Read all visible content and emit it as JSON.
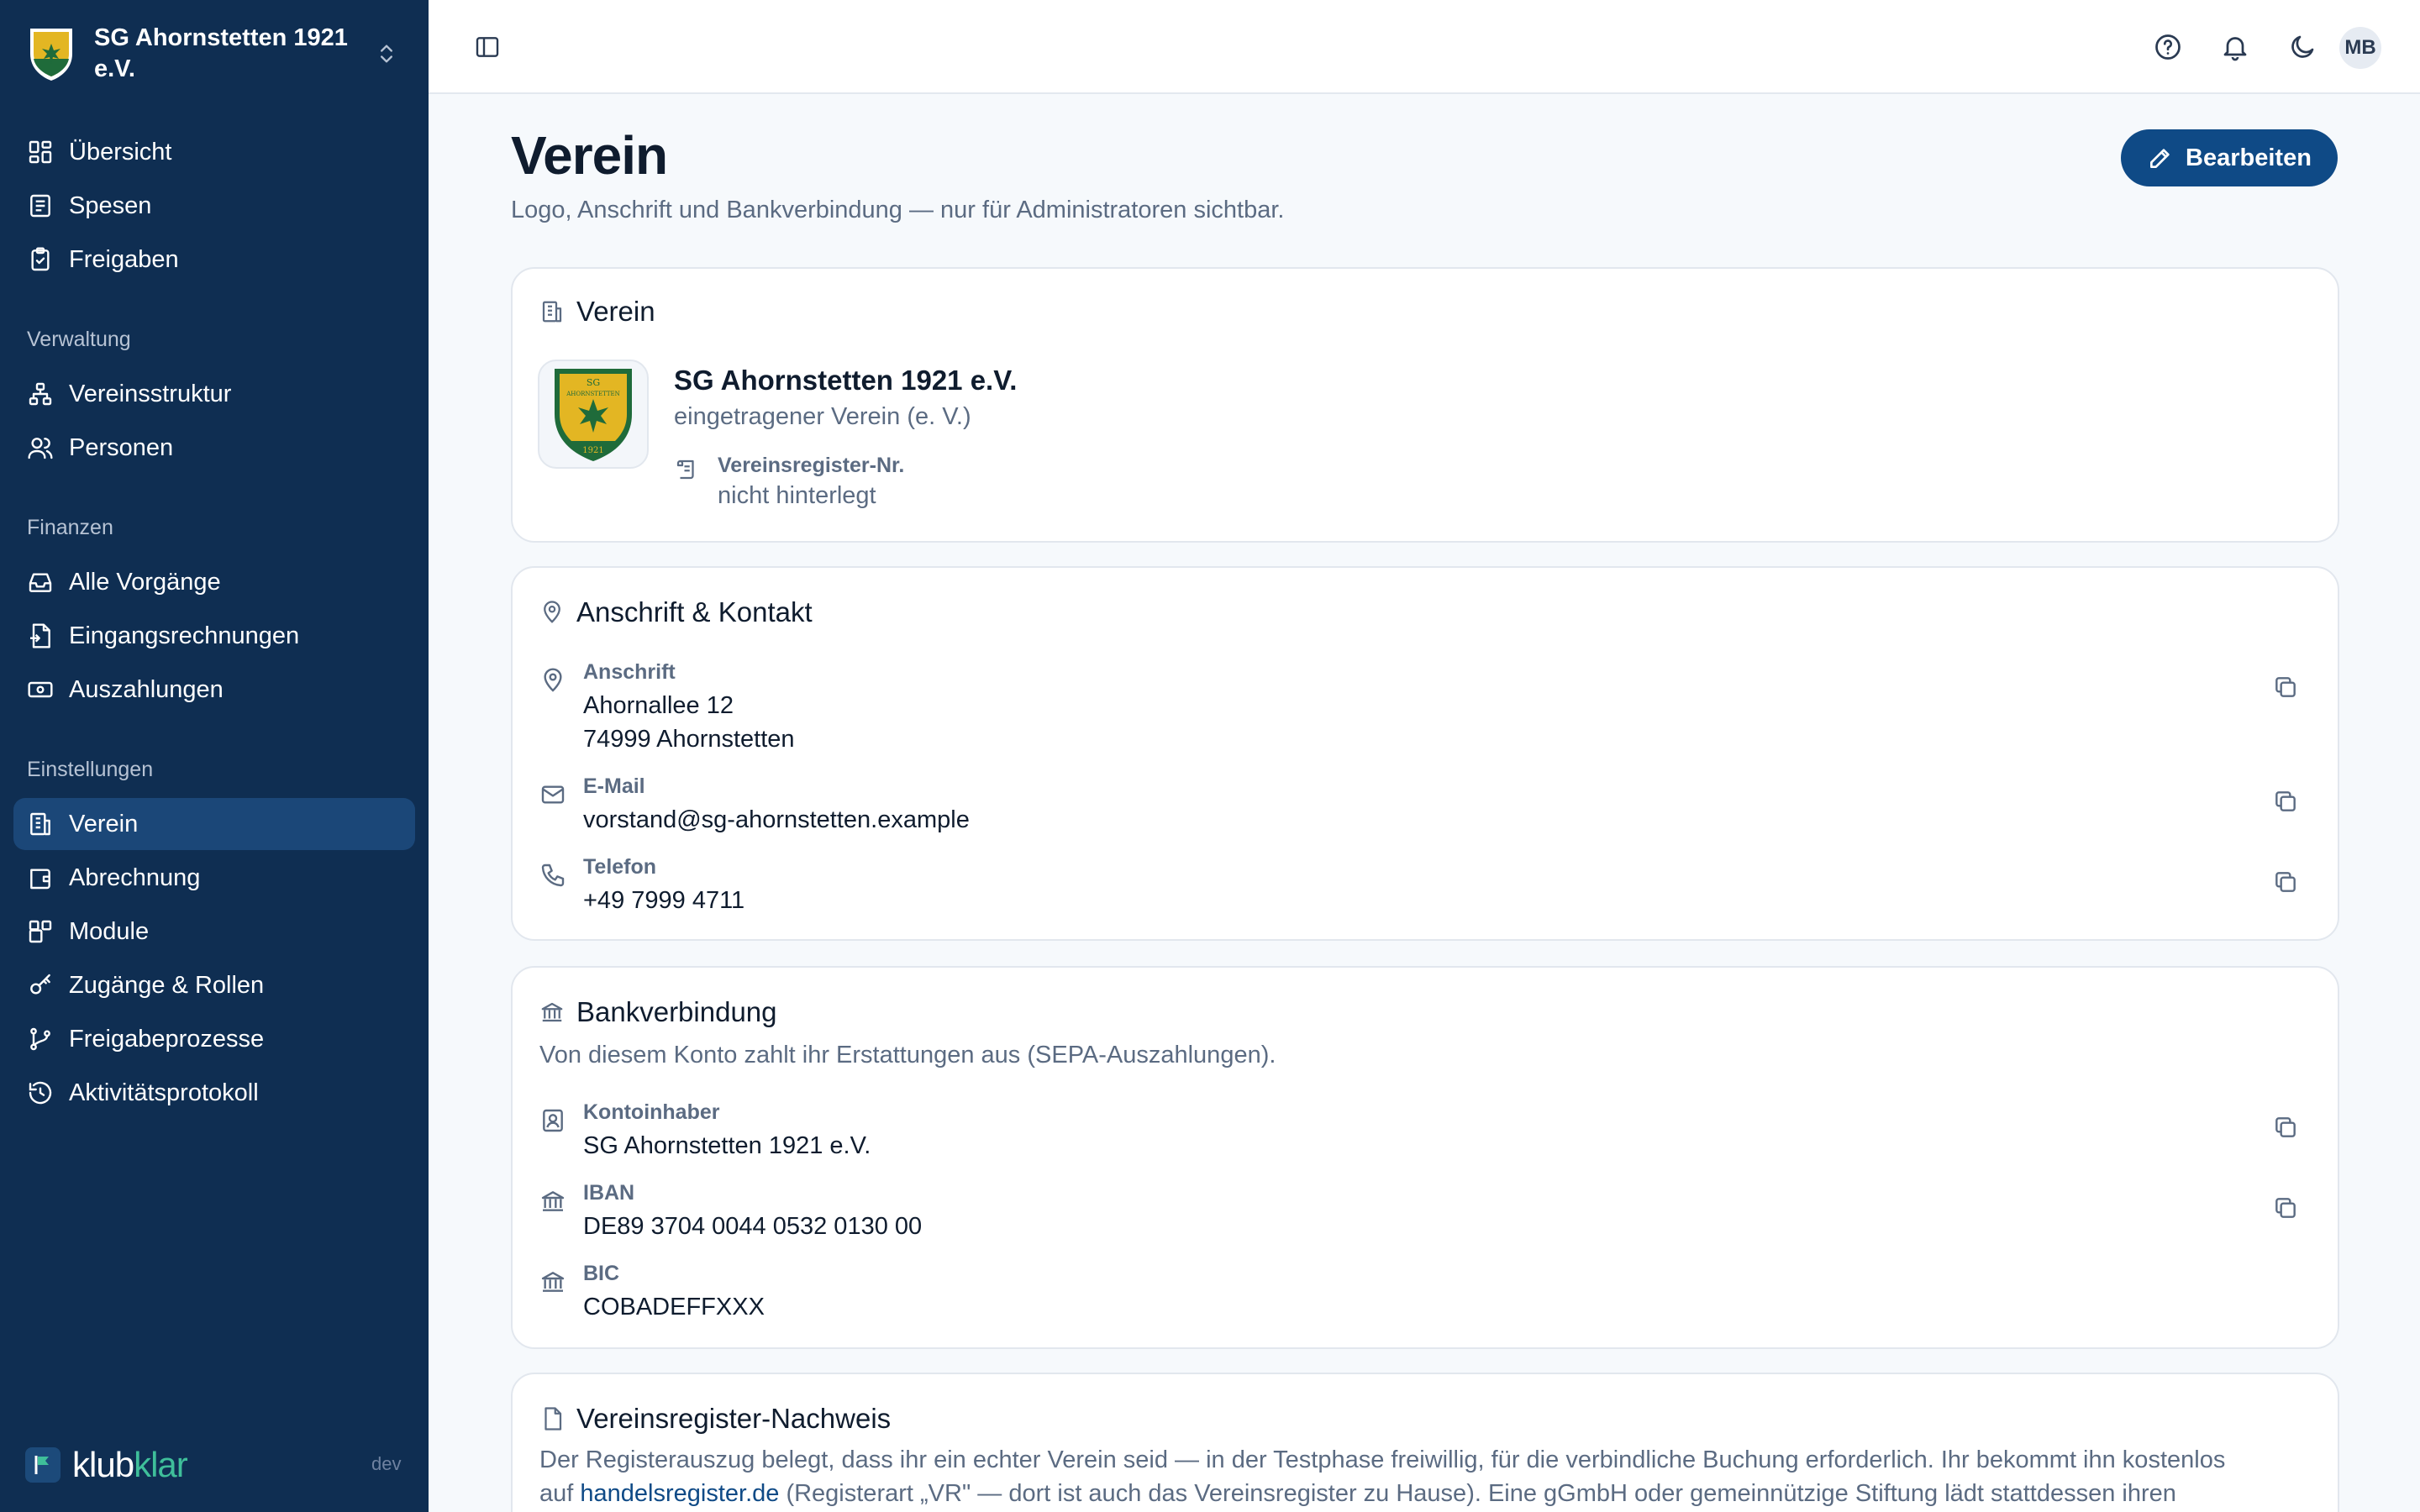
{
  "sidebar": {
    "club_name": "SG Ahornstetten 1921 e.V.",
    "items_top": [
      {
        "label": "Übersicht"
      },
      {
        "label": "Spesen"
      },
      {
        "label": "Freigaben"
      }
    ],
    "groups": [
      {
        "title": "Verwaltung",
        "items": [
          {
            "label": "Vereinsstruktur"
          },
          {
            "label": "Personen"
          }
        ]
      },
      {
        "title": "Finanzen",
        "items": [
          {
            "label": "Alle Vorgänge"
          },
          {
            "label": "Eingangsrechnungen"
          },
          {
            "label": "Auszahlungen"
          }
        ]
      },
      {
        "title": "Einstellungen",
        "items": [
          {
            "label": "Verein",
            "active": true
          },
          {
            "label": "Abrechnung"
          },
          {
            "label": "Module"
          },
          {
            "label": "Zugänge & Rollen"
          },
          {
            "label": "Freigabeprozesse"
          },
          {
            "label": "Aktivitätsprotokoll"
          }
        ]
      }
    ],
    "brand": {
      "part1": "klub",
      "part2": "klar"
    },
    "env": "dev"
  },
  "topbar": {
    "avatar_initials": "MB"
  },
  "page": {
    "title": "Verein",
    "subtitle": "Logo, Anschrift und Bankverbindung — nur für Administratoren sichtbar.",
    "edit_label": "Bearbeiten"
  },
  "verein_card": {
    "title": "Verein",
    "name": "SG Ahornstetten 1921 e.V.",
    "legal_form": "eingetragener Verein (e. V.)",
    "register_label": "Vereinsregister-Nr.",
    "register_value": "nicht hinterlegt",
    "logo_text_top": "SG",
    "logo_text_mid": "AHORNSTETTEN",
    "logo_text_year": "1921"
  },
  "contact_card": {
    "title": "Anschrift & Kontakt",
    "address_label": "Anschrift",
    "address_line1": "Ahornallee 12",
    "address_line2": "74999 Ahornstetten",
    "email_label": "E-Mail",
    "email_value": "vorstand@sg-ahornstetten.example",
    "phone_label": "Telefon",
    "phone_value": "+49 7999 4711"
  },
  "bank_card": {
    "title": "Bankverbindung",
    "description": "Von diesem Konto zahlt ihr Erstattungen aus (SEPA-Auszahlungen).",
    "holder_label": "Kontoinhaber",
    "holder_value": "SG Ahornstetten 1921 e.V.",
    "iban_label": "IBAN",
    "iban_value": "DE89 3704 0044 0532 0130 00",
    "bic_label": "BIC",
    "bic_value": "COBADEFFXXX"
  },
  "register_card": {
    "title": "Vereinsregister-Nachweis",
    "text_line1": "Der Registerauszug belegt, dass ihr ein echter Verein seid — in der Testphase freiwillig, für die verbindliche Buchung erforderlich. Ihr bekommt ihn kostenlos",
    "text_prefix": "auf",
    "link_text": "handelsregister.de",
    "text_line2": "(Registerart „VR\" — dort ist auch das Vereinsregister zu Hause). Eine gGmbH oder gemeinnützige Stiftung lädt stattdessen ihren"
  },
  "colors": {
    "sidebar_bg": "#0f2e52",
    "sidebar_active": "#1b4778",
    "accent": "#0f4a86",
    "brand_green": "#3fbf9a"
  }
}
